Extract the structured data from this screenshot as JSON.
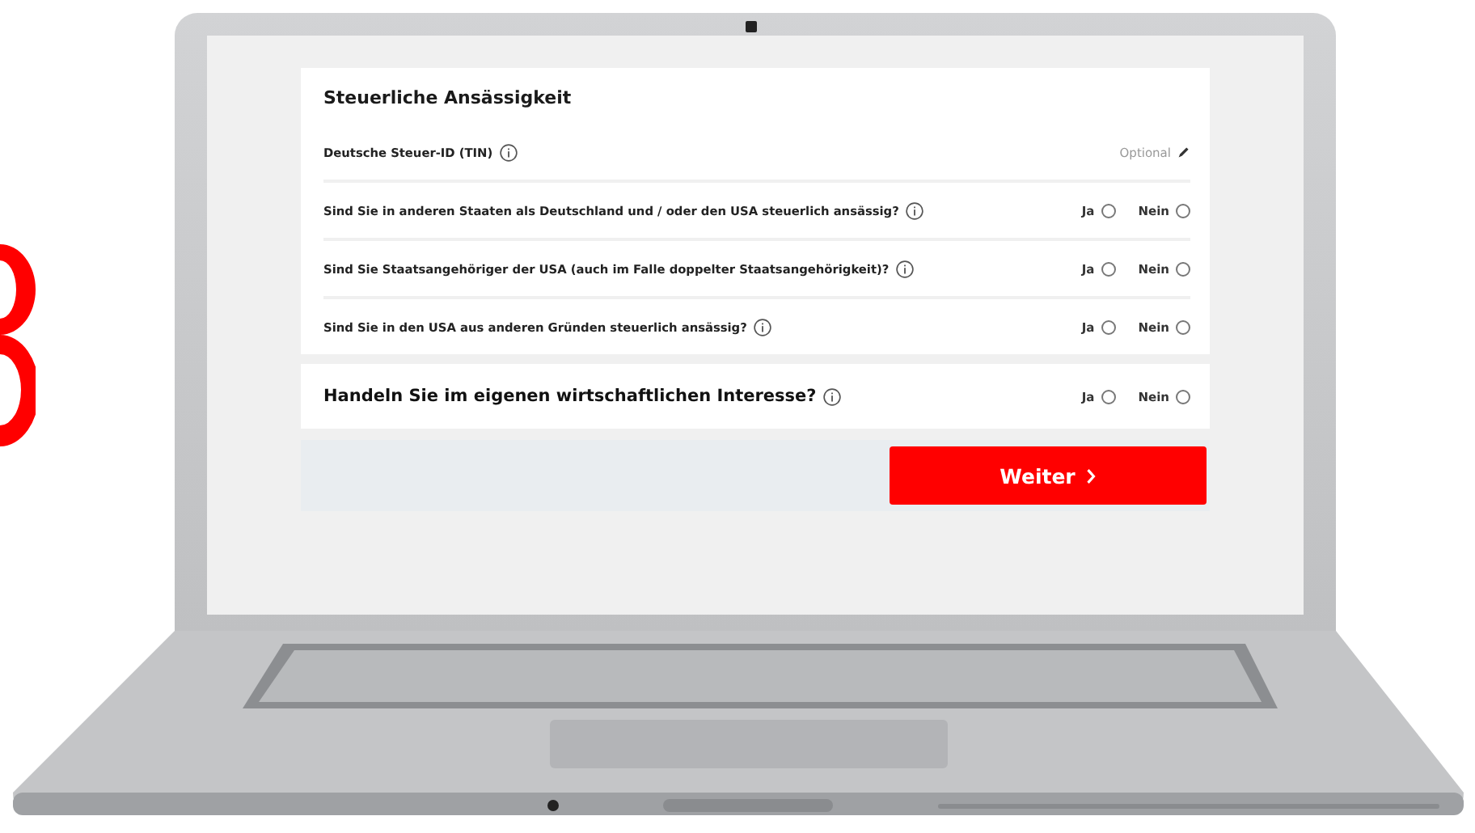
{
  "section": {
    "title": "Steuerliche Ansässigkeit",
    "tin": {
      "label": "Deutsche Steuer-ID (TIN)",
      "placeholder": "Optional"
    },
    "questions": [
      {
        "text": "Sind Sie in anderen Staaten als Deutschland und / oder den USA steuerlich ansässig?",
        "options": [
          {
            "label": "Ja",
            "selected": false
          },
          {
            "label": "Nein",
            "selected": false
          }
        ]
      },
      {
        "text": "Sind Sie Staatsangehöriger der USA (auch im Falle doppelter Staatsangehörigkeit)?",
        "options": [
          {
            "label": "Ja",
            "selected": false
          },
          {
            "label": "Nein",
            "selected": false
          }
        ]
      },
      {
        "text": "Sind Sie in den USA aus anderen Gründen steuerlich ansässig?",
        "options": [
          {
            "label": "Ja",
            "selected": false
          },
          {
            "label": "Nein",
            "selected": false
          }
        ]
      }
    ]
  },
  "interest": {
    "text": "Handeln Sie im eigenen wirtschaftlichen Interesse?",
    "options": [
      {
        "label": "Ja",
        "selected": false
      },
      {
        "label": "Nein",
        "selected": false
      }
    ]
  },
  "next_button": {
    "label": "Weiter"
  }
}
